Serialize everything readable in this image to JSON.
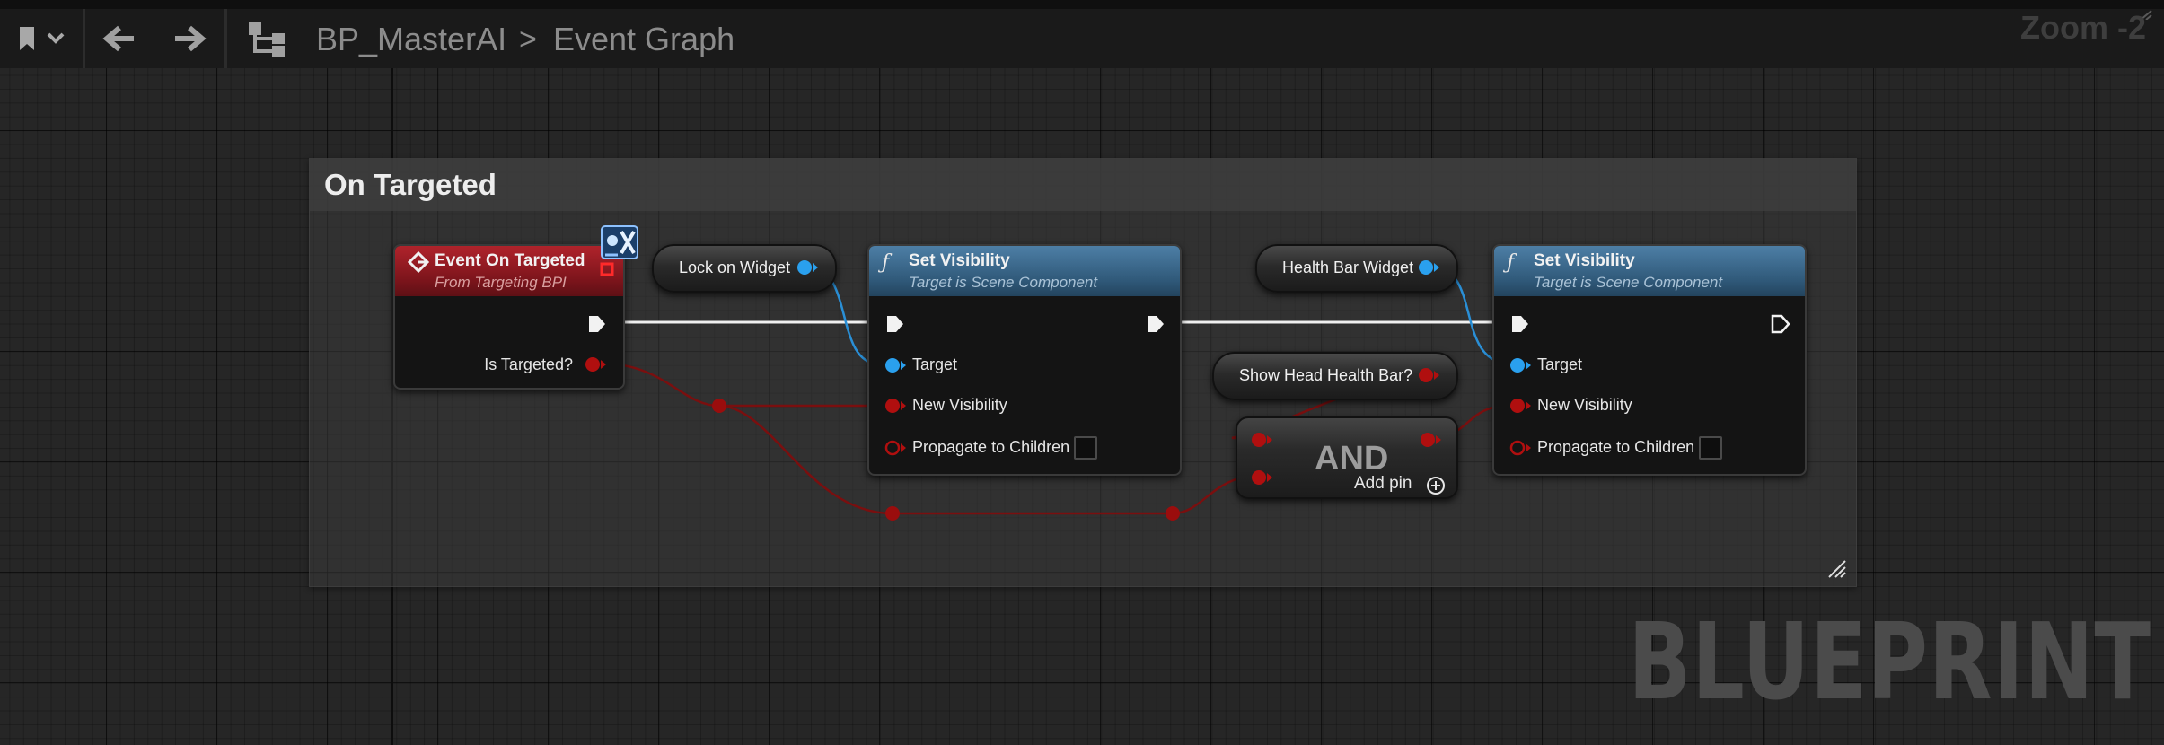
{
  "toolbar": {
    "back_icon": "arrow-left-icon",
    "forward_icon": "arrow-right-icon",
    "bookmark_icon": "bookmark-icon",
    "hierarchy_icon": "graph-hierarchy-icon"
  },
  "breadcrumb": {
    "blueprint_name": "BP_MasterAI",
    "separator": ">",
    "graph_name": "Event Graph"
  },
  "zoom_label": "Zoom -2",
  "comment_box": {
    "title": "On Targeted"
  },
  "nodes": {
    "event_on_targeted": {
      "title": "Event On Targeted",
      "subtitle": "From Targeting BPI",
      "pin_is_targeted": "Is Targeted?",
      "header_color": "#a31f27"
    },
    "lock_on_widget": {
      "label": "Lock on Widget"
    },
    "set_visibility_1": {
      "title": "Set Visibility",
      "subtitle": "Target is Scene Component",
      "pin_target": "Target",
      "pin_new_visibility": "New Visibility",
      "pin_propagate": "Propagate to Children",
      "header_color": "#3f6f95"
    },
    "health_bar_widget": {
      "label": "Health Bar Widget"
    },
    "show_head_health_bar": {
      "label": "Show Head Health Bar?"
    },
    "and_node": {
      "title": "AND",
      "add_pin_label": "Add pin"
    },
    "set_visibility_2": {
      "title": "Set Visibility",
      "subtitle": "Target is Scene Component",
      "pin_target": "Target",
      "pin_new_visibility": "New Visibility",
      "pin_propagate": "Propagate to Children",
      "header_color": "#3f6f95"
    }
  },
  "colors": {
    "object_pin": "#2aa0ee",
    "bool_pin": "#9a0d0d",
    "exec_pin": "#f2f2f2"
  },
  "watermark": "BLUEPRINT"
}
